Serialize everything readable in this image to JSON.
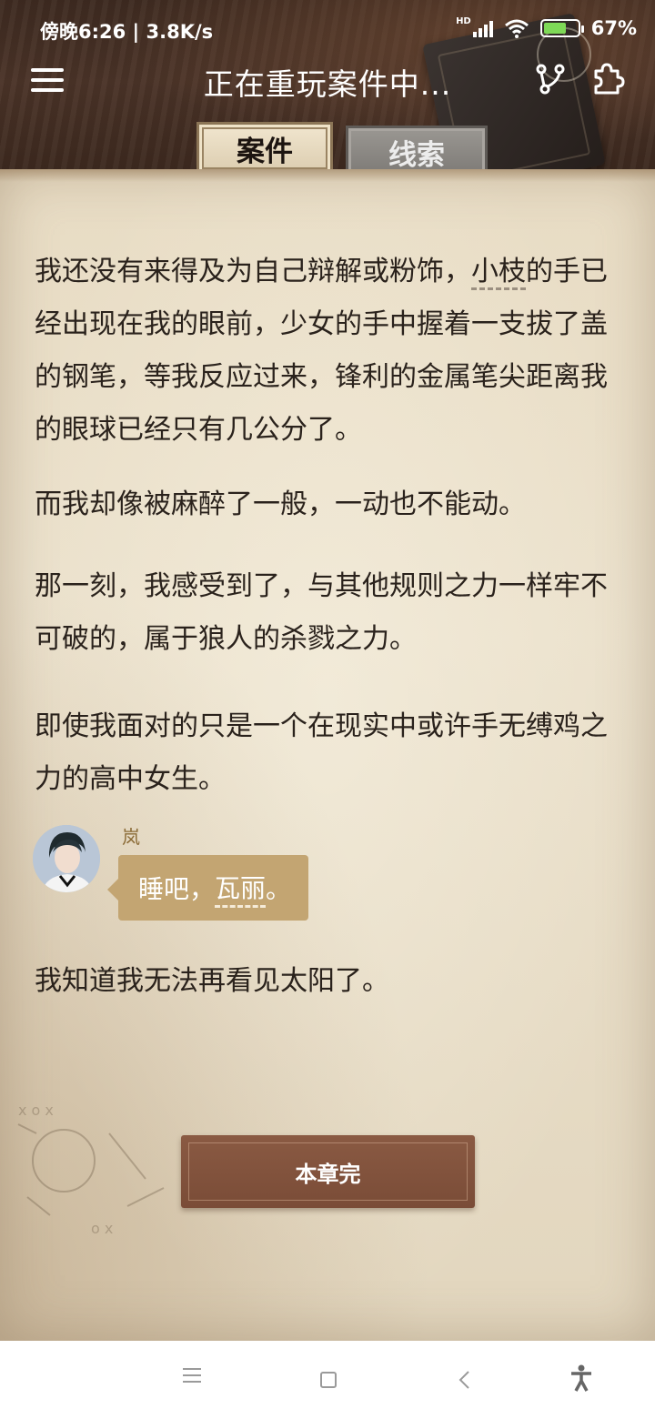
{
  "status_bar": {
    "time": "傍晚6:26 | 3.8K/s",
    "network_label": "HD",
    "battery": "67%",
    "battery_level": 0.67
  },
  "header": {
    "title": "正在重玩案件中..."
  },
  "tabs": [
    {
      "label": "案件",
      "active": true
    },
    {
      "label": "线索",
      "active": false
    }
  ],
  "story": {
    "p1_a": "我还没有来得及为自己辩解或粉饰，",
    "p1_name": "小枝",
    "p1_b": "的手已经出现在我的眼前，少女的手中握着一支拔了盖的钢笔，等我反应过来，锋利的金属笔尖距离我的眼球已经只有几公分了。",
    "p2": "而我却像被麻醉了一般，一动也不能动。",
    "p3": "那一刻，我感受到了，与其他规则之力一样牢不可破的，属于狼人的杀戮之力。",
    "p4": "即使我面对的只是一个在现实中或许手无缚鸡之力的高中女生。",
    "dialog": {
      "speaker": "岚",
      "text_a": "睡吧，",
      "text_name": "瓦丽",
      "text_b": "。"
    },
    "p5": "我知道我无法再看见太阳了。"
  },
  "chapter_end_button": "本章完",
  "colors": {
    "paper": "#e8dcc4",
    "bubble": "#c3a572",
    "button": "#7a4c37",
    "speaker": "#8a6a35"
  }
}
